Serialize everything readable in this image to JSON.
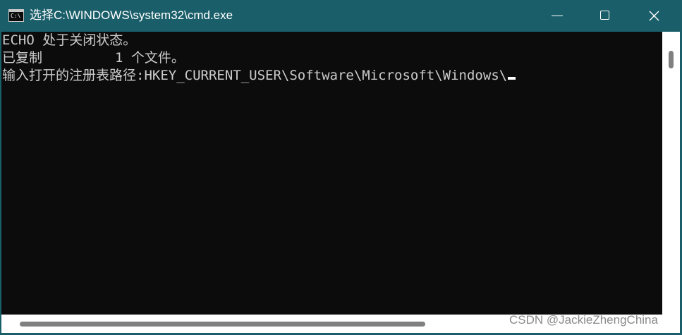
{
  "window": {
    "title": "选择C:\\WINDOWS\\system32\\cmd.exe",
    "icon": "cmd-icon",
    "icon_text": "C:\\",
    "controls": {
      "minimize": "minimize-icon",
      "maximize": "maximize-icon",
      "close": "close-icon"
    }
  },
  "console": {
    "lines": [
      "ECHO 处于关闭状态。",
      "已复制         1 个文件。",
      "输入打开的注册表路径:HKEY_CURRENT_USER\\Software\\Microsoft\\Windows\\"
    ]
  },
  "watermark": "CSDN @JackieZhengChina",
  "colors": {
    "titlebar": "#1a5e6a",
    "console_bg": "#0c0c0c",
    "console_text": "#cccccc"
  }
}
